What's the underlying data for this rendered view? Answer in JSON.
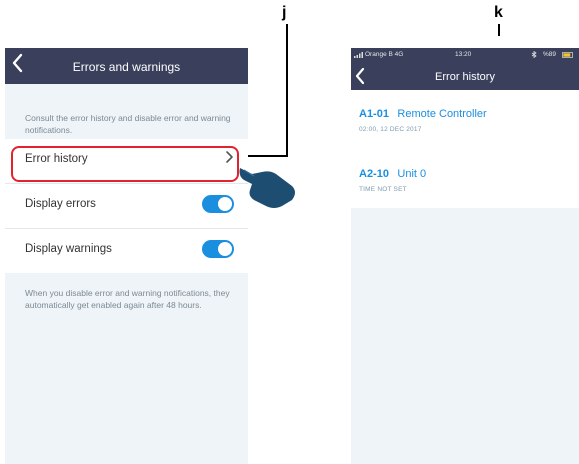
{
  "callouts": {
    "j": "j",
    "k": "k"
  },
  "left_screen": {
    "nav_title": "Errors and warnings",
    "intro": "Consult the error history and disable error and warning notifications.",
    "rows": [
      {
        "label": "Error history",
        "type": "link"
      },
      {
        "label": "Display errors",
        "type": "toggle",
        "on": true
      },
      {
        "label": "Display warnings",
        "type": "toggle",
        "on": true
      }
    ],
    "footer": "When you disable error and warning notifications, they automatically get enabled again after 48 hours."
  },
  "right_screen": {
    "status": {
      "carrier": "Orange B  4G",
      "time": "13:20",
      "battery": "%89"
    },
    "nav_title": "Error history",
    "items": [
      {
        "code": "A1-01",
        "name": "Remote Controller",
        "sub": "02:00, 12 DEC 2017"
      },
      {
        "code": "A2-10",
        "name": "Unit 0",
        "sub": "TIME NOT SET"
      }
    ]
  },
  "colors": {
    "nav": "#3a3f5c",
    "accent": "#1a8fe0",
    "highlight": "#e2232e",
    "background": "#eef4f8"
  },
  "icons": [
    "back-chevron-icon",
    "chevron-right-icon",
    "pointing-hand-icon",
    "signal-icon",
    "bluetooth-icon",
    "battery-icon"
  ]
}
